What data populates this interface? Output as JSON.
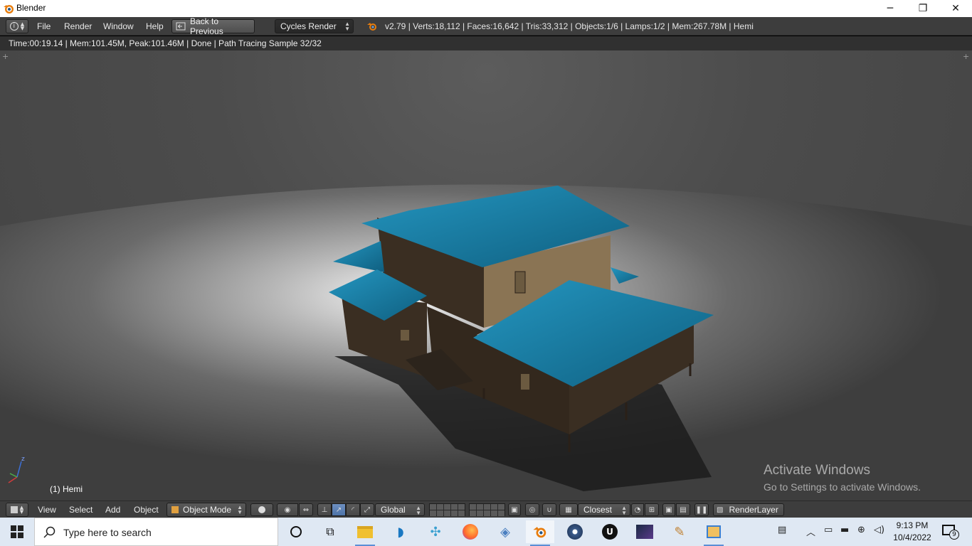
{
  "window": {
    "title": "Blender",
    "icon": "blender-icon",
    "controls": {
      "minimize": "─",
      "maximize": "❐",
      "close": "✕"
    }
  },
  "info_header": {
    "editor_type_icon": "info-icon",
    "menus": [
      "File",
      "Render",
      "Window",
      "Help"
    ],
    "back_button": "Back to Previous",
    "render_engine": "Cycles Render",
    "stats": "v2.79 | Verts:18,112 | Faces:16,642 | Tris:33,312 | Objects:1/6 | Lamps:1/2 | Mem:267.78M | Hemi"
  },
  "render_status": "Time:00:19.14 | Mem:101.45M, Peak:101.46M | Done | Path Tracing Sample 32/32",
  "viewport": {
    "active_object": "(1) Hemi",
    "axis_labels": {
      "z": "z"
    },
    "scene_colors": {
      "roof": "#1a7fa3",
      "wall": "#4a3a2a",
      "ground": "#6e6e6e"
    }
  },
  "view3d_header": {
    "menus": [
      "View",
      "Select",
      "Add",
      "Object"
    ],
    "mode": "Object Mode",
    "transform_orientation": "Global",
    "snap_target": "Closest",
    "render_layer": "RenderLayer"
  },
  "watermark": {
    "line1": "Activate Windows",
    "line2": "Go to Settings to activate Windows."
  },
  "taskbar": {
    "search_placeholder": "Type here to search",
    "apps": [
      "cortana-icon",
      "task-view-icon",
      "file-explorer-icon",
      "dolphin-app-icon",
      "network-app-icon",
      "firefox-icon",
      "settings-app-icon",
      "blender-icon",
      "media-app-icon",
      "unreal-icon",
      "photos-app-icon",
      "paint-icon",
      "video-app-icon"
    ],
    "time": "9:13 PM",
    "date": "10/4/2022",
    "notification_count": "9"
  },
  "colors": {
    "header_bg": "#3d3d3d",
    "accent_blue": "#5a8fd6",
    "taskbar_bg": "#dfe8f3"
  }
}
